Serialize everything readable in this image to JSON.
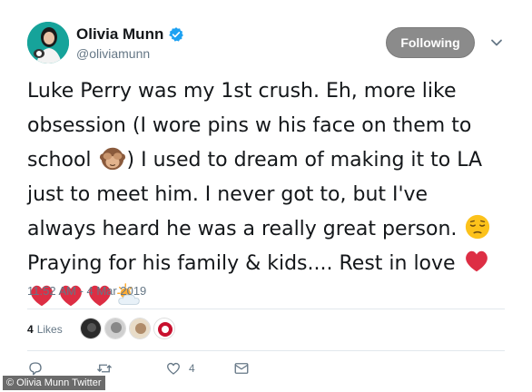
{
  "user": {
    "display_name": "Olivia Munn",
    "handle": "@oliviamunn",
    "verified": true
  },
  "follow_button": {
    "label": "Following"
  },
  "tweet": {
    "lines": [
      "Luke Perry was my 1st crush. Eh, more like",
      "obsession (I wore pins w his face on them to",
      "school ",
      ") I used to dream of making it to LA",
      "just to meet him. I never got to, but I've",
      "always heard he was a really great person. ",
      "Praying for his family & kids.... Rest in love "
    ],
    "emojis": [
      "see-no-evil-monkey",
      "pensive-face",
      "red-heart",
      "red-heart",
      "red-heart",
      "red-heart",
      "sun-behind-cloud"
    ]
  },
  "timestamp": "11:52 AM - 4 Mar 2019",
  "stats": {
    "likes_count": "4",
    "likes_label": "Likes"
  },
  "actions": {
    "like_count": "4"
  },
  "watermark": "© Olivia Munn Twitter",
  "colors": {
    "text": "#14171a",
    "secondary": "#657786",
    "verified": "#1da1f2",
    "heart": "#e0245e",
    "follow_bg": "#8b8b8b"
  }
}
